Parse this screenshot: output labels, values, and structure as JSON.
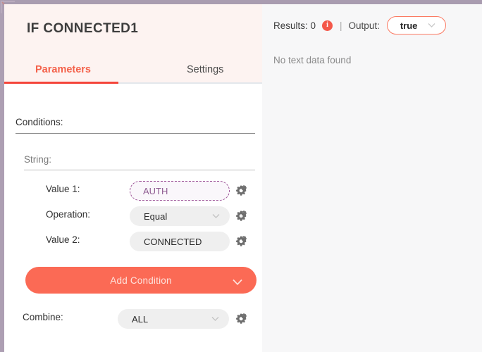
{
  "window": {
    "chrome_color": "#a99cb0"
  },
  "left_panel": {
    "title": "IF CONNECTED1",
    "header_bg": "#fdf3f1",
    "accent_color": "#f4614a",
    "tabs": [
      {
        "label": "Parameters",
        "active": true
      },
      {
        "label": "Settings",
        "active": false
      }
    ],
    "conditions_label": "Conditions:",
    "string_label": "String:",
    "rows": [
      {
        "label": "Value 1:",
        "value": "AUTH",
        "style": "dashed-variable",
        "has_chevron": false,
        "gear_icon": "gear-icon",
        "border_color": "#9a4f95",
        "text_color": "#8f5c92"
      },
      {
        "label": "Operation:",
        "value": "Equal",
        "style": "solid-dropdown",
        "has_chevron": true,
        "gear_icon": "gear-icon"
      },
      {
        "label": "Value 2:",
        "value": "CONNECTED",
        "style": "solid",
        "has_chevron": false,
        "gear_icon": "gear-icon"
      }
    ],
    "add_condition": {
      "label": "Add Condition",
      "color": "#fb6a55",
      "chevron_icon": "chevron-down-icon"
    },
    "combine": {
      "label": "Combine:",
      "value": "ALL",
      "has_chevron": true,
      "gear_icon": "gear-icon"
    }
  },
  "right_panel": {
    "bg": "#f7f7f8",
    "results_label": "Results: 0",
    "info_icon_glyph": "i",
    "info_icon_color": "#f4584a",
    "separator": "|",
    "output_label": "Output:",
    "output_value": "true",
    "output_border_color": "#fb7a63",
    "empty_message": "No text data found"
  }
}
